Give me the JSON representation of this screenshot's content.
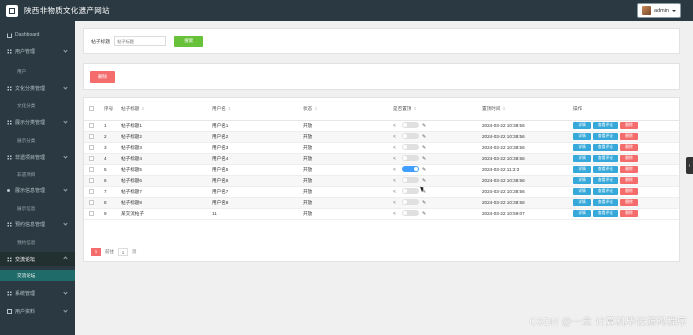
{
  "header": {
    "title": "陕西非物质文化遗产网站",
    "user": "admin"
  },
  "sidebar": {
    "items": [
      {
        "label": "Dashboard",
        "icon": "home-icon"
      },
      {
        "label": "用户管理",
        "icon": "grid-icon",
        "children": [
          "用户"
        ]
      },
      {
        "label": "文化分类管理",
        "icon": "grid-icon",
        "children": [
          "文化分类"
        ]
      },
      {
        "label": "展示分类管理",
        "icon": "grid-icon",
        "children": [
          "展示分类"
        ]
      },
      {
        "label": "非遗项目管理",
        "icon": "grid-icon",
        "children": [
          "非遗项目"
        ]
      },
      {
        "label": "展示信息管理",
        "icon": "bullet-icon",
        "children": [
          "展示信息"
        ]
      },
      {
        "label": "预约信息管理",
        "icon": "grid-icon",
        "children": [
          "预约信息"
        ]
      },
      {
        "label": "交流论坛",
        "icon": "grid-icon",
        "children": [
          "交流论坛"
        ]
      },
      {
        "label": "系统管理",
        "icon": "grid-icon"
      },
      {
        "label": "用户资料",
        "icon": "doc-icon"
      }
    ]
  },
  "search": {
    "label": "帖子标题",
    "placeholder": "帖子标题",
    "button": "搜索"
  },
  "actions": {
    "delete": "删除"
  },
  "table": {
    "headers": [
      "序号",
      "帖子标题",
      "用户名",
      "状态",
      "是否置顶",
      "置顶时间",
      "操作"
    ],
    "rows": [
      {
        "no": "1",
        "title": "帖子标题1",
        "user": "用户名1",
        "status": "开放",
        "top": false,
        "time": "2024-03-22 10:38:56"
      },
      {
        "no": "2",
        "title": "帖子标题2",
        "user": "用户名2",
        "status": "开放",
        "top": false,
        "time": "2024-03-22 10:38:56"
      },
      {
        "no": "3",
        "title": "帖子标题3",
        "user": "用户名3",
        "status": "开放",
        "top": false,
        "time": "2024-03-22 10:38:56"
      },
      {
        "no": "4",
        "title": "帖子标题4",
        "user": "用户名4",
        "status": "开放",
        "top": false,
        "time": "2024-03-22 10:38:56"
      },
      {
        "no": "5",
        "title": "帖子标题5",
        "user": "用户名5",
        "status": "开放",
        "top": true,
        "time": "2024-03-22 11:2:3"
      },
      {
        "no": "6",
        "title": "帖子标题6",
        "user": "用户名6",
        "status": "开放",
        "top": false,
        "time": "2024-03-22 10:38:56"
      },
      {
        "no": "7",
        "title": "帖子标题7",
        "user": "用户名7",
        "status": "开放",
        "top": false,
        "time": "2024-03-22 10:38:56"
      },
      {
        "no": "8",
        "title": "帖子标题8",
        "user": "用户名8",
        "status": "开放",
        "top": false,
        "time": "2024-03-22 10:38:56"
      },
      {
        "no": "9",
        "title": "某交流帖子",
        "user": "11",
        "status": "开放",
        "top": false,
        "time": "2024-03-22 10:59:07"
      }
    ],
    "ops": {
      "detail": "详情",
      "comment": "查看评论",
      "delete": "删除"
    }
  },
  "pager": {
    "current": "1",
    "goto_label": "前往",
    "goto_value": "1",
    "page_unit": "页"
  },
  "watermark": "CSDN @一念 计算机毕设源码程序",
  "colors": {
    "sidebar": "#2b3a42",
    "active": "#1f6b6a",
    "primary": "#409eff",
    "success": "#67c23a",
    "danger": "#f56c6c",
    "info": "#36a8d9"
  }
}
